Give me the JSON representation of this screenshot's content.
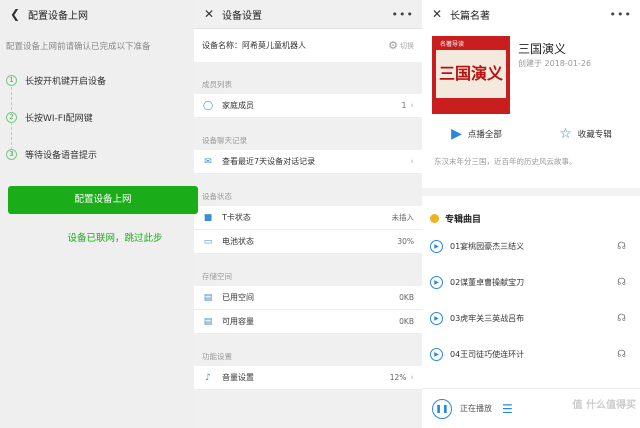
{
  "setup_screen": {
    "title": "配置设备上网",
    "intro": "配置设备上网前请确认已完成以下准备",
    "steps": [
      "长按开机键开启设备",
      "长按WI-FI配网键",
      "等待设备语音提示"
    ],
    "configure_button": "配置设备上网",
    "skip_link": "设备已联网，跳过此步"
  },
  "settings_screen": {
    "title": "设备设置",
    "device_name_label": "设备名称：阿希莫儿童机器人",
    "switch_label": "切换",
    "members_section": "成员列表",
    "family_member_label": "家庭成员",
    "family_member_count": "1",
    "chat_section": "设备聊天记录",
    "chat_row_label": "查看最近7天设备对话记录",
    "status_section": "设备状态",
    "tcard_label": "T卡状态",
    "tcard_value": "未插入",
    "battery_label": "电池状态",
    "battery_value": "30%",
    "storage_section": "存储空间",
    "used_label": "已用空间",
    "used_value": "0KB",
    "available_label": "可用容量",
    "available_value": "0KB",
    "function_section": "功能设置",
    "volume_label": "音量设置",
    "volume_value": "12%"
  },
  "album_screen": {
    "title": "长篇名著",
    "album_art_text": "三国演义",
    "album_tag": "名著导读",
    "album_title": "三国演义",
    "created": "创建于 2018-01-26",
    "play_all": "点播全部",
    "collect": "收藏专辑",
    "description": "东汉末年分三国，近百年的历史风云故事。",
    "tracks_heading": "专辑曲目",
    "tracks": [
      "01宴桃园豪杰三结义",
      "02谋董卓曹操献宝刀",
      "03虎牢关三英战吕布",
      "04王司徒巧使连环计"
    ],
    "now_playing": "正在播放"
  },
  "watermark": "值 什么值得买"
}
